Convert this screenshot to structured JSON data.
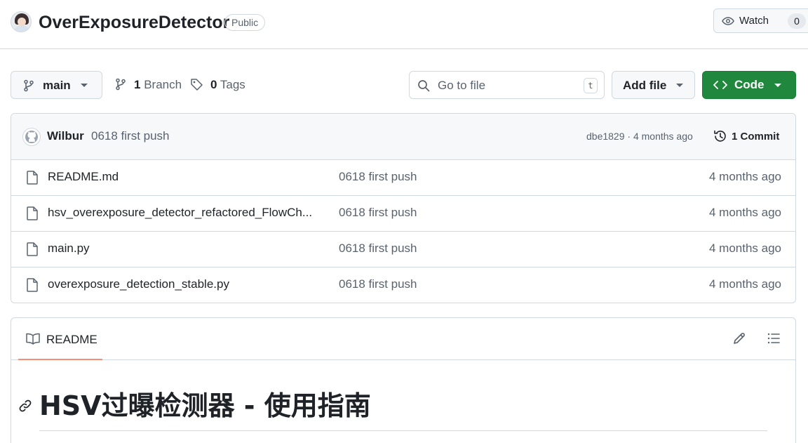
{
  "repo": {
    "name": "OverExposureDetector",
    "visibility": "Public",
    "watch_label": "Watch",
    "watch_count": "0"
  },
  "toolbar": {
    "branch": "main",
    "branch_count": "1",
    "branch_label": "Branch",
    "tag_count": "0",
    "tag_label": "Tags",
    "search_placeholder": "Go to file",
    "search_shortcut": "t",
    "add_file_label": "Add file",
    "code_label": "Code"
  },
  "latest_commit": {
    "author": "Wilbur",
    "message": "0618 first push",
    "meta": "dbe1829 · 4 months ago",
    "count_label": "1 Commit"
  },
  "files": [
    {
      "name": "README.md",
      "message": "0618 first push",
      "age": "4 months ago"
    },
    {
      "name": "hsv_overexposure_detector_refactored_FlowCh...",
      "message": "0618 first push",
      "age": "4 months ago"
    },
    {
      "name": "main.py",
      "message": "0618 first push",
      "age": "4 months ago"
    },
    {
      "name": "overexposure_detection_stable.py",
      "message": "0618 first push",
      "age": "4 months ago"
    }
  ],
  "readme": {
    "tab_label": "README",
    "heading": "HSV过曝检测器 - 使用指南"
  },
  "colors": {
    "code_button": "#1f883d",
    "readme_tab_underline": "#fd8c73",
    "border": "#d1d9e0",
    "muted_text": "#59636e"
  }
}
